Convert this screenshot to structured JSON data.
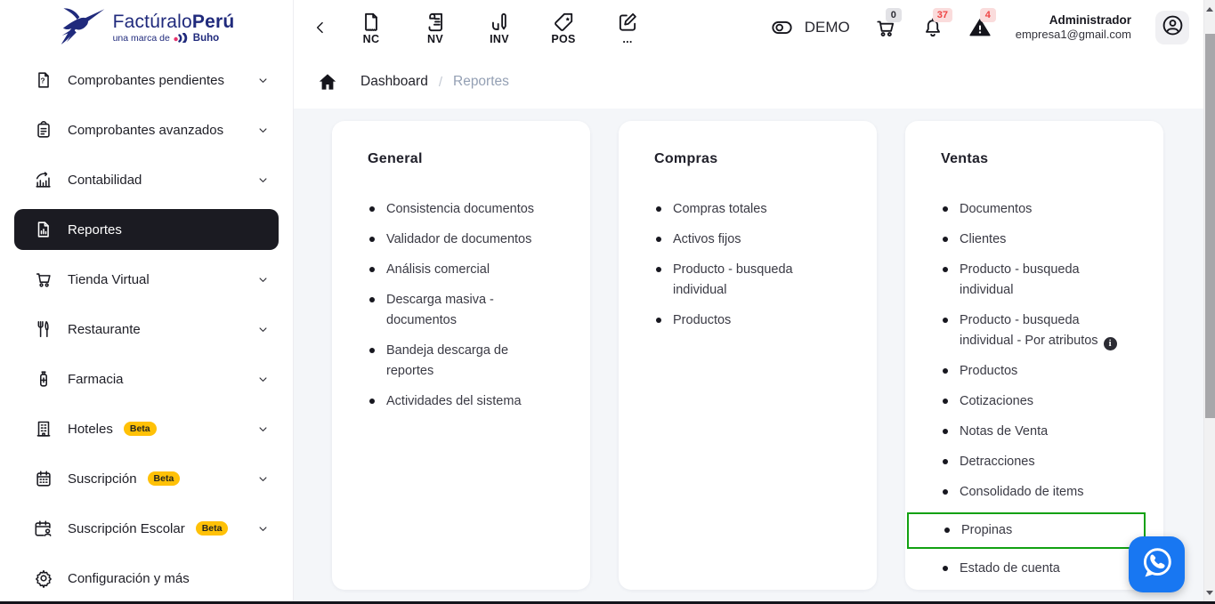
{
  "brand": {
    "logo_text_regular": "Factúralo",
    "logo_text_bold": "Perú",
    "tagline": "una marca de",
    "tagline_brand": "Buho"
  },
  "sidebar": {
    "items": [
      {
        "label": "Comprobantes pendientes",
        "icon": "document-question-icon",
        "chevron": true
      },
      {
        "label": "Comprobantes avanzados",
        "icon": "clipboard-icon",
        "chevron": true
      },
      {
        "label": "Contabilidad",
        "icon": "finance-chart-icon",
        "chevron": true
      },
      {
        "label": "Reportes",
        "icon": "report-document-icon",
        "chevron": false,
        "active": true
      },
      {
        "label": "Tienda Virtual",
        "icon": "shopping-cart-icon",
        "chevron": true
      },
      {
        "label": "Restaurante",
        "icon": "restaurant-icon",
        "chevron": true
      },
      {
        "label": "Farmacia",
        "icon": "pharmacy-icon",
        "chevron": true
      },
      {
        "label": "Hoteles",
        "icon": "hotel-icon",
        "chevron": true,
        "beta": "Beta"
      },
      {
        "label": "Suscripción",
        "icon": "calendar-icon",
        "chevron": true,
        "beta": "Beta"
      },
      {
        "label": "Suscripción Escolar",
        "icon": "calendar-person-icon",
        "chevron": true,
        "beta": "Beta"
      },
      {
        "label": "Configuración y más",
        "icon": "gear-icon",
        "chevron": false
      }
    ]
  },
  "toolbar": {
    "doc_buttons": [
      {
        "label": "NC",
        "icon": "credit-note-document-icon"
      },
      {
        "label": "NV",
        "icon": "sales-note-receipt-icon"
      },
      {
        "label": "INV",
        "icon": "inventory-pen-icon"
      },
      {
        "label": "POS",
        "icon": "pos-price-tag-icon"
      },
      {
        "label": "...",
        "icon": "more-documents-edit-icon"
      }
    ],
    "demo_label": "DEMO",
    "cart_badge": "0",
    "notifications_badge": "37",
    "alerts_badge": "4",
    "user": {
      "name": "Administrador",
      "email": "empresa1@gmail.com"
    }
  },
  "breadcrumb": {
    "items": [
      "Dashboard",
      "Reportes"
    ],
    "separator": "/"
  },
  "cards": [
    {
      "title": "General",
      "items": [
        {
          "label": "Consistencia documentos"
        },
        {
          "label": "Validador de documentos"
        },
        {
          "label": "Análisis comercial"
        },
        {
          "label": "Descarga masiva - documentos"
        },
        {
          "label": "Bandeja descarga de reportes"
        },
        {
          "label": "Actividades del sistema"
        }
      ]
    },
    {
      "title": "Compras",
      "items": [
        {
          "label": "Compras totales"
        },
        {
          "label": "Activos fijos"
        },
        {
          "label": "Producto - busqueda individual"
        },
        {
          "label": "Productos"
        }
      ]
    },
    {
      "title": "Ventas",
      "items": [
        {
          "label": "Documentos"
        },
        {
          "label": "Clientes"
        },
        {
          "label": "Producto - busqueda individual"
        },
        {
          "label": "Producto - busqueda individual - Por atributos",
          "info_icon": true
        },
        {
          "label": "Productos"
        },
        {
          "label": "Cotizaciones"
        },
        {
          "label": "Notas de Venta"
        },
        {
          "label": "Detracciones"
        },
        {
          "label": "Consolidado de items"
        },
        {
          "label": "Propinas",
          "highlighted": true
        },
        {
          "label": "Estado de cuenta"
        }
      ]
    }
  ],
  "colors": {
    "brand_navy": "#202a7c",
    "accent_pink": "#e8336d",
    "accent_green": "#12a112",
    "active_item_bg": "#1b1b22",
    "badge_gray_bg": "#e2e2e6",
    "badge_red_bg": "#fadcdc",
    "badge_red_text": "#ef4444",
    "beta_bg": "#ffc107",
    "whatsapp_blue": "#1877f2",
    "content_bg": "#f4f6f9"
  }
}
